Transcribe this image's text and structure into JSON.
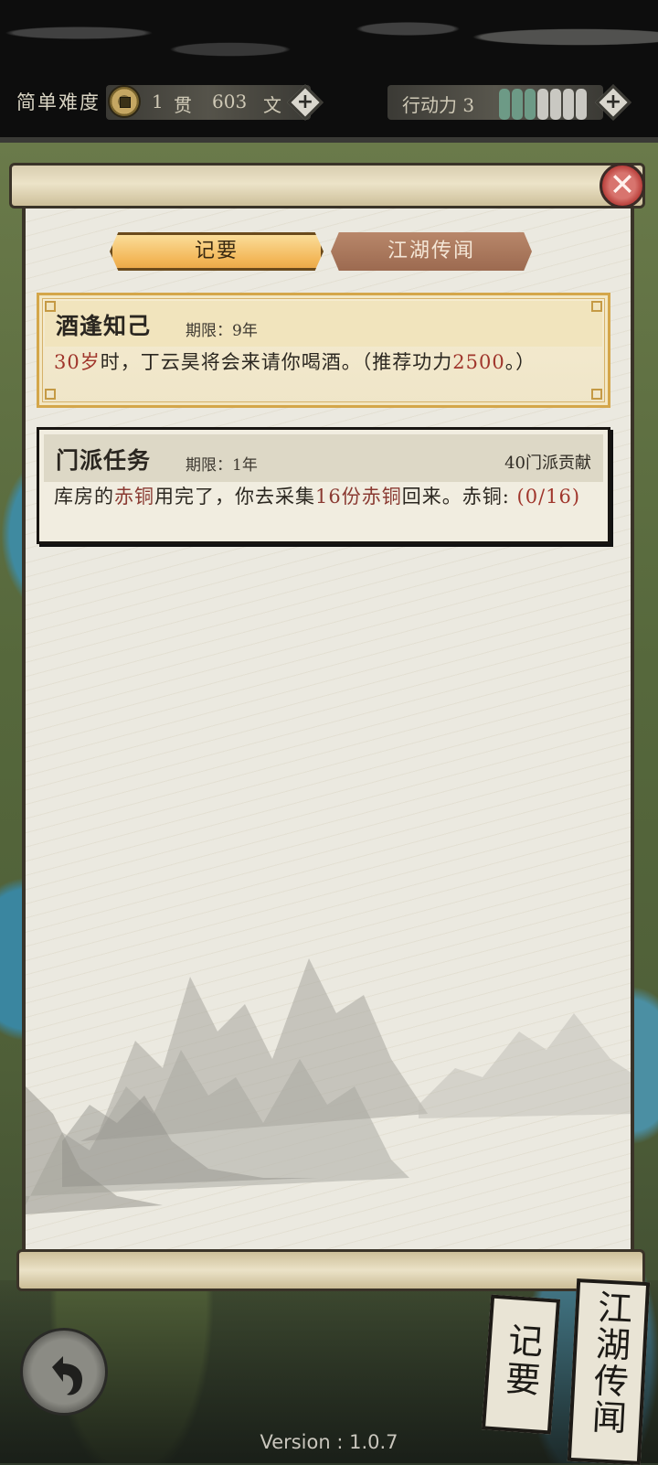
{
  "header": {
    "difficulty": "简单难度",
    "money": {
      "guan_amount": "1",
      "guan_unit": "贯",
      "wen_amount": "603",
      "wen_unit": "文"
    },
    "action_points": {
      "label": "行动力 3",
      "pips_filled": 3,
      "pips_total": 7
    },
    "plus_symbol": "+"
  },
  "tabs": [
    {
      "label": "记要",
      "active": true
    },
    {
      "label": "江湖传闻",
      "active": false
    }
  ],
  "close_symbol": "✕",
  "tasks": [
    {
      "title": "酒逢知己",
      "deadline": "期限：9年",
      "desc": {
        "p1": "30岁",
        "p2": "时，丁云昊将会来请你喝酒。（推荐功力",
        "p3": "2500",
        "p4": "。）"
      }
    },
    {
      "title": "门派任务",
      "deadline": "期限：1年",
      "reward": "40门派贡献",
      "desc": {
        "p1": "库房的",
        "p2": "赤铜",
        "p3": "用完了，你去采集",
        "p4": "16份赤铜",
        "p5": "回来。赤铜: ",
        "p6": "(0/16)"
      }
    }
  ],
  "side_tabs": {
    "notes": "记要",
    "rumors": "江湖传闻"
  },
  "version": "Version : 1.0.7",
  "colors": {
    "accent_gold": "#f3b85a",
    "highlight_red": "#a0362c",
    "ap_pip": "#6d9a86"
  }
}
